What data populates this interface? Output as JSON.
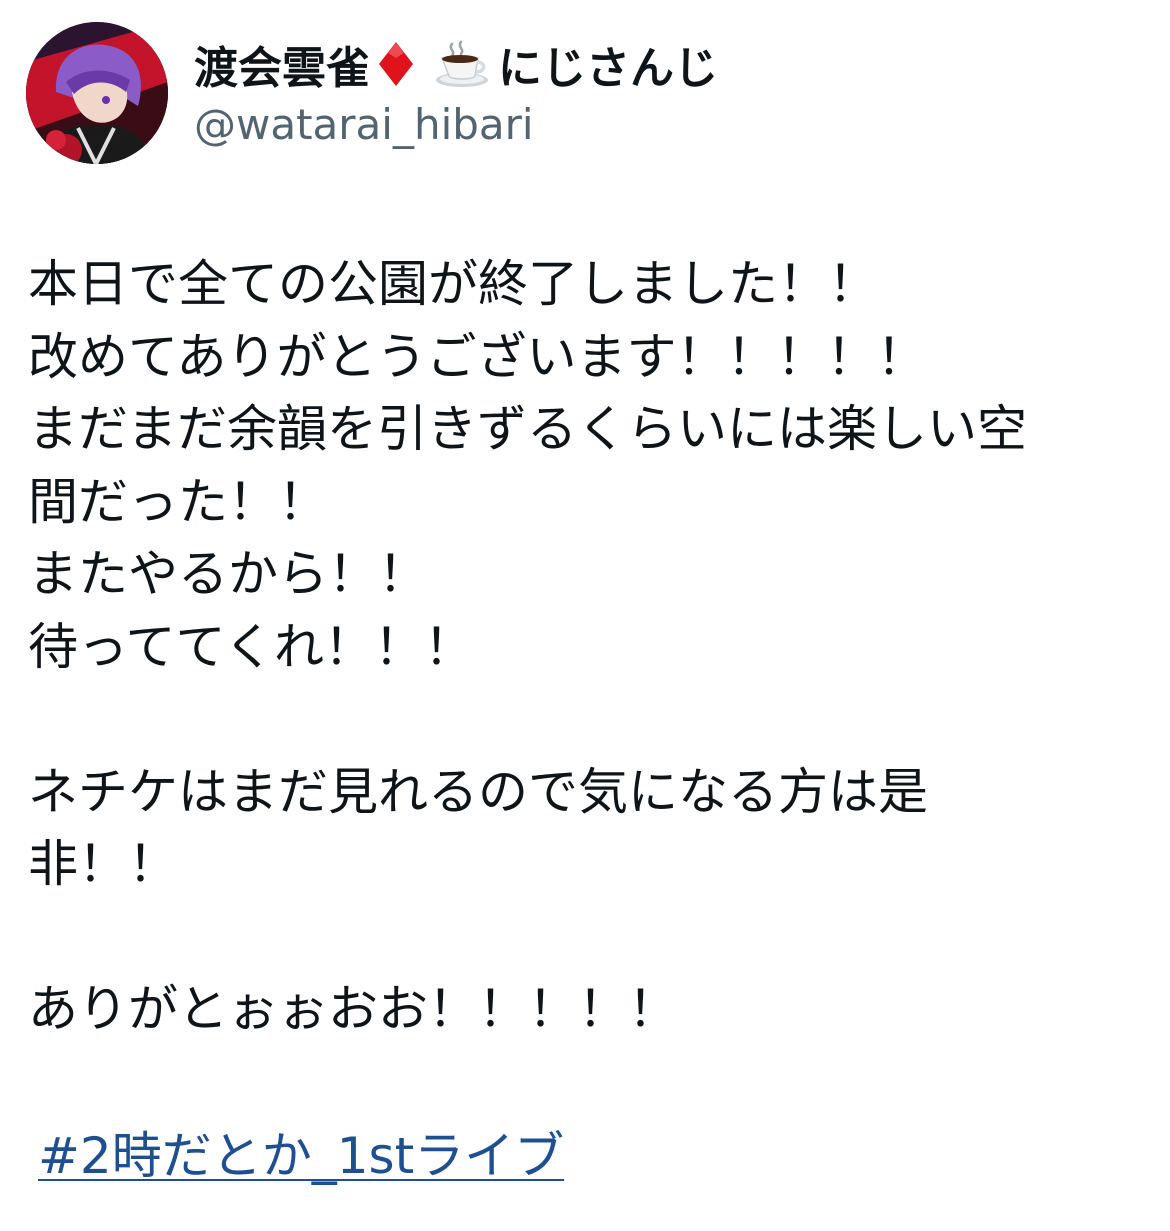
{
  "author": {
    "display_name": "渡会雲雀",
    "org_name": "にじさんじ",
    "handle": "@watarai_hibari",
    "emoji_icons": [
      "red-diamond-icon",
      "hot-beverage-icon"
    ]
  },
  "tweet": {
    "lines": [
      "本日で全ての公園が終了しました！！",
      "改めてありがとうございます！！！！！",
      "まだまだ余韻を引きずるくらいには楽しい空",
      "間だった！！",
      "またやるから！！",
      "待っててくれ！！！",
      "",
      "ネチケはまだ見れるので気になる方は是",
      "非！！",
      "",
      "ありがとぉぉおお！！！！！"
    ],
    "hashtag": "#2時だとか_1stライブ"
  },
  "colors": {
    "text": "#0f1419",
    "handle": "#536471",
    "link": "#1d4f91",
    "diamond": "#e0121b"
  }
}
